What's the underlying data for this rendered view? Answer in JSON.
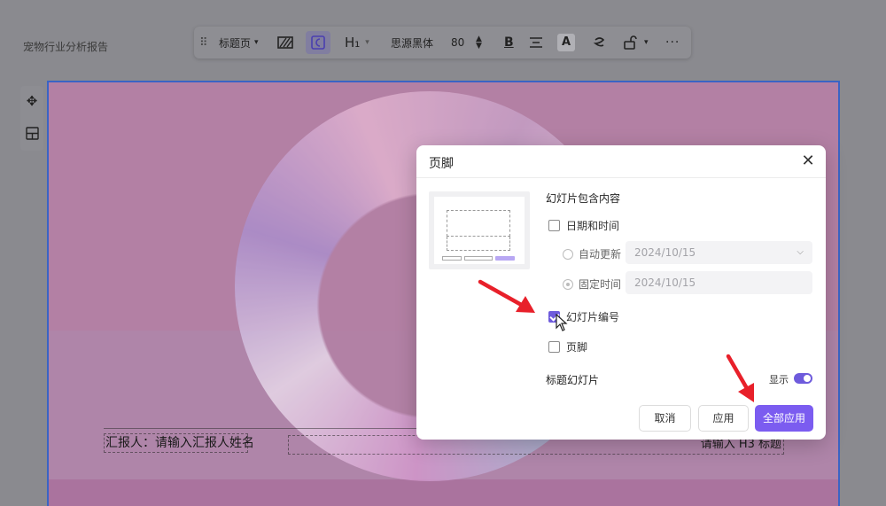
{
  "document": {
    "title": "宠物行业分析报告"
  },
  "toolbar": {
    "layout_label": "标题页",
    "heading_label": "H₁",
    "font_name": "思源黑体",
    "font_size": "80",
    "bold_label": "B",
    "color_label": "A"
  },
  "slide": {
    "reporter_text": "汇报人：请输入汇报人姓名",
    "h3_placeholder": "请输入 H3 标题"
  },
  "dialog": {
    "title": "页脚",
    "section_title": "幻灯片包含内容",
    "date_time": {
      "label": "日期和时间",
      "checked": false
    },
    "auto_update": {
      "label": "自动更新",
      "value": "2024/10/15",
      "selected": false
    },
    "fixed_time": {
      "label": "固定时间",
      "value": "2024/10/15",
      "selected": true
    },
    "slide_number": {
      "label": "幻灯片编号",
      "checked": true
    },
    "footer": {
      "label": "页脚",
      "checked": false
    },
    "title_slide": {
      "label": "标题幻灯片",
      "toggle_label": "显示",
      "enabled": true
    },
    "buttons": {
      "cancel": "取消",
      "apply": "应用",
      "apply_all": "全部应用"
    }
  },
  "colors": {
    "accent": "#7b5cf0",
    "annotation_arrow": "#e8202a",
    "slide_border": "#3a64c4"
  }
}
